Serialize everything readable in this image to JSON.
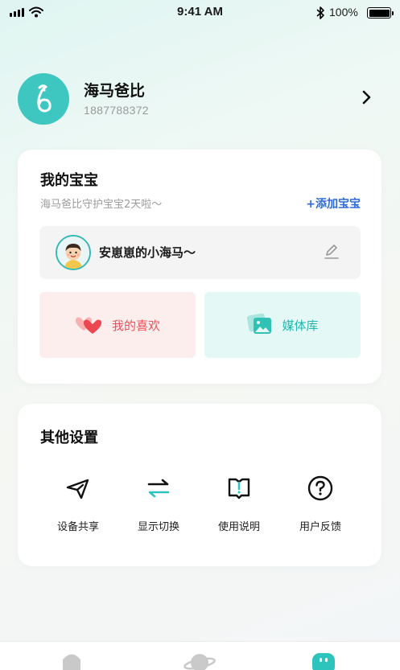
{
  "status_bar": {
    "time": "9:41 AM",
    "battery_percent": "100%",
    "icons": [
      "signal-icon",
      "wifi-icon",
      "bluetooth-icon",
      "battery-icon"
    ]
  },
  "profile": {
    "name": "海马爸比",
    "phone": "1887788372",
    "avatar_icon": "seahorse-logo-icon",
    "chevron_icon": "chevron-right-icon"
  },
  "baby_card": {
    "title": "我的宝宝",
    "subtitle": "海马爸比守护宝宝2天啦～",
    "add_label": "+添加宝宝",
    "baby": {
      "name": "安崽崽的小海马～",
      "edit_icon": "edit-icon"
    },
    "tiles": [
      {
        "label": "我的喜欢",
        "icon": "heart-icon"
      },
      {
        "label": "媒体库",
        "icon": "gallery-icon"
      }
    ]
  },
  "settings_card": {
    "title": "其他设置",
    "items": [
      {
        "label": "设备共享",
        "icon": "send-icon"
      },
      {
        "label": "显示切换",
        "icon": "switch-icon"
      },
      {
        "label": "使用说明",
        "icon": "manual-icon"
      },
      {
        "label": "用户反馈",
        "icon": "help-icon"
      }
    ]
  },
  "bottom_nav": {
    "items": [
      "home-icon",
      "planet-icon",
      "robot-icon"
    ],
    "active_index": 2
  },
  "colors": {
    "accent": "#3ec7c0",
    "link": "#2f6bd6",
    "favorite": "#e9525a",
    "media": "#24b7ad"
  }
}
